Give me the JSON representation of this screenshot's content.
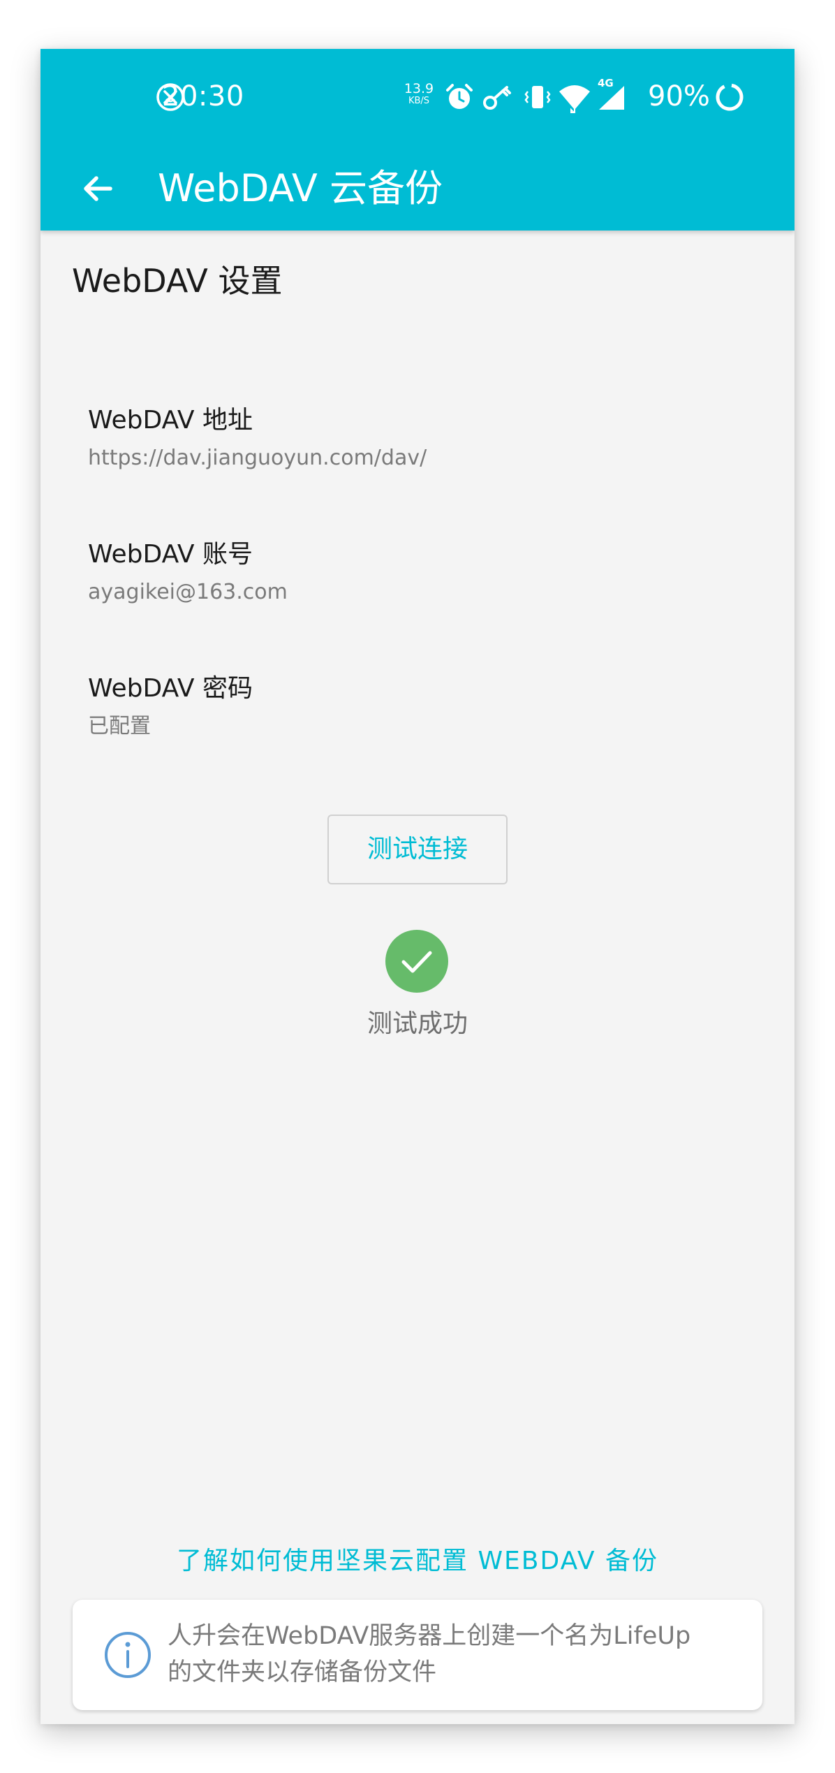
{
  "status_bar": {
    "time": "20:30",
    "net_speed_value": "13.9",
    "net_speed_unit": "KB/S",
    "network_type": "4G",
    "battery": "90%",
    "icons": [
      "notification-blocked-icon",
      "alarm-icon",
      "vpn-key-icon",
      "vibrate-icon",
      "wifi-icon",
      "signal-icon",
      "battery-ring-icon"
    ]
  },
  "app_bar": {
    "back_icon": "arrow-left-icon",
    "title": "WebDAV 云备份"
  },
  "settings": {
    "section_title": "WebDAV 设置",
    "items": [
      {
        "title": "WebDAV 地址",
        "summary": "https://dav.jianguoyun.com/dav/"
      },
      {
        "title": "WebDAV 账号",
        "summary": "ayagikei@163.com"
      },
      {
        "title": "WebDAV 密码",
        "summary": "已配置"
      }
    ]
  },
  "test": {
    "button_label": "测试连接",
    "result_icon": "check-circle-icon",
    "result_text": "测试成功"
  },
  "help_link": "了解如何使用坚果云配置 WEBDAV 备份",
  "info_card": {
    "icon": "info-icon",
    "text_line1": "人升会在WebDAV服务器上创建一个名为LifeUp",
    "text_line2": "的文件夹以存储备份文件"
  },
  "colors": {
    "primary": "#00bcd4",
    "background": "#f4f4f4",
    "success": "#66bb6a",
    "info_icon": "#5b9bd5"
  }
}
